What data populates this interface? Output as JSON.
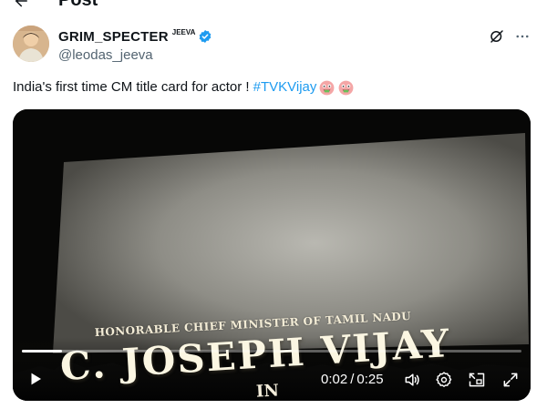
{
  "header": {
    "title": "Post",
    "back_icon": "back-arrow-icon"
  },
  "author": {
    "display_name": "GRIM_SPECTER",
    "name_tag": "JEEVA",
    "handle": "@leodas_jeeva",
    "verified_color": "#1d9bf0",
    "avatar_icon": "avatar"
  },
  "actions": {
    "grok_icon": "grok-icon",
    "more_icon": "more-icon"
  },
  "tweet": {
    "text": "India's first time CM title card for actor !",
    "hashtag": "#TVKVijay",
    "emojis": [
      "money-mouth-face",
      "money-mouth-face"
    ]
  },
  "video": {
    "headline": "Honorable Chief Minister of Tamil Nadu",
    "name": "C. JOSEPH VIJAY",
    "in_text": "IN",
    "current_time": "0:02",
    "separator": "/",
    "duration": "0:25",
    "progress": 0.08,
    "controls": [
      "play-icon",
      "volume-icon",
      "settings-icon",
      "picture-in-picture-icon",
      "fullscreen-icon"
    ]
  }
}
